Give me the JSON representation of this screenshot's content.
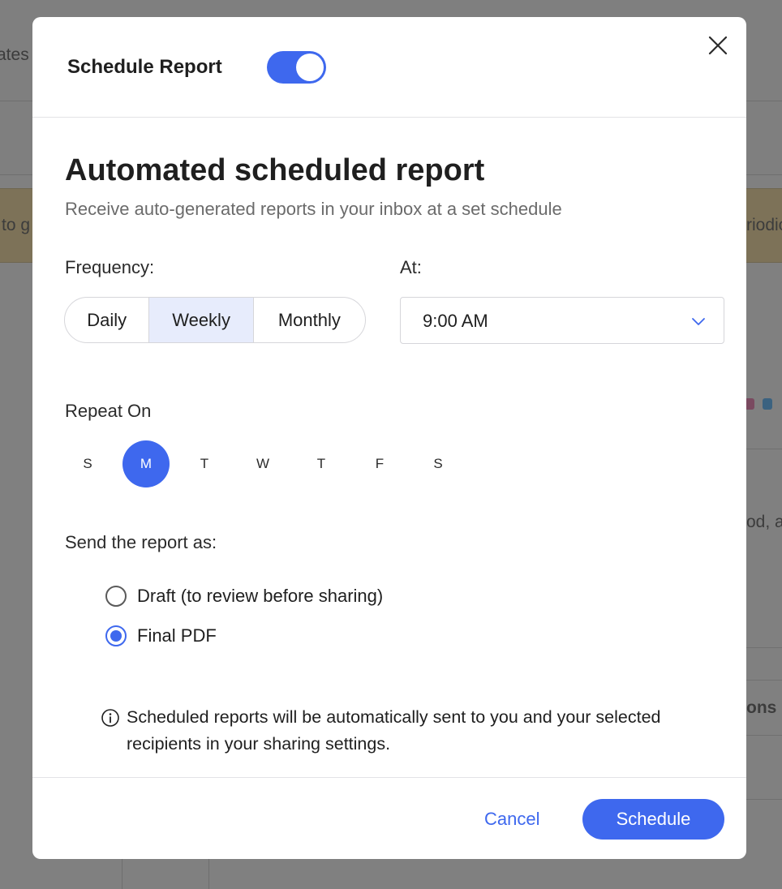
{
  "background": {
    "fragments": [
      "ates",
      "to g",
      "riodic",
      "od, al",
      "ons"
    ]
  },
  "modal": {
    "header": {
      "title": "Schedule Report",
      "toggle_on": true,
      "close_icon": "close-icon"
    },
    "title": "Automated scheduled report",
    "subtitle": "Receive auto-generated reports in your inbox at a set schedule",
    "frequency": {
      "label": "Frequency:",
      "options": [
        "Daily",
        "Weekly",
        "Monthly"
      ],
      "selected": "Weekly"
    },
    "at": {
      "label": "At:",
      "value": "9:00 AM",
      "icon": "chevron-down-icon"
    },
    "repeat_on": {
      "label": "Repeat On",
      "days": [
        "S",
        "M",
        "T",
        "W",
        "T",
        "F",
        "S"
      ],
      "selected_index": 1
    },
    "send_as": {
      "label": "Send the report as:",
      "options": [
        {
          "label": "Draft (to review before sharing)",
          "checked": false
        },
        {
          "label": "Final PDF",
          "checked": true
        }
      ]
    },
    "info": {
      "icon": "info-icon",
      "text": "Scheduled reports will be automatically sent to you and your selected recipients in your sharing settings."
    },
    "footer": {
      "cancel_label": "Cancel",
      "schedule_label": "Schedule"
    }
  },
  "colors": {
    "accent": "#3e68ee",
    "selected_segment": "#e7ecfc",
    "overlay": "#808080"
  }
}
